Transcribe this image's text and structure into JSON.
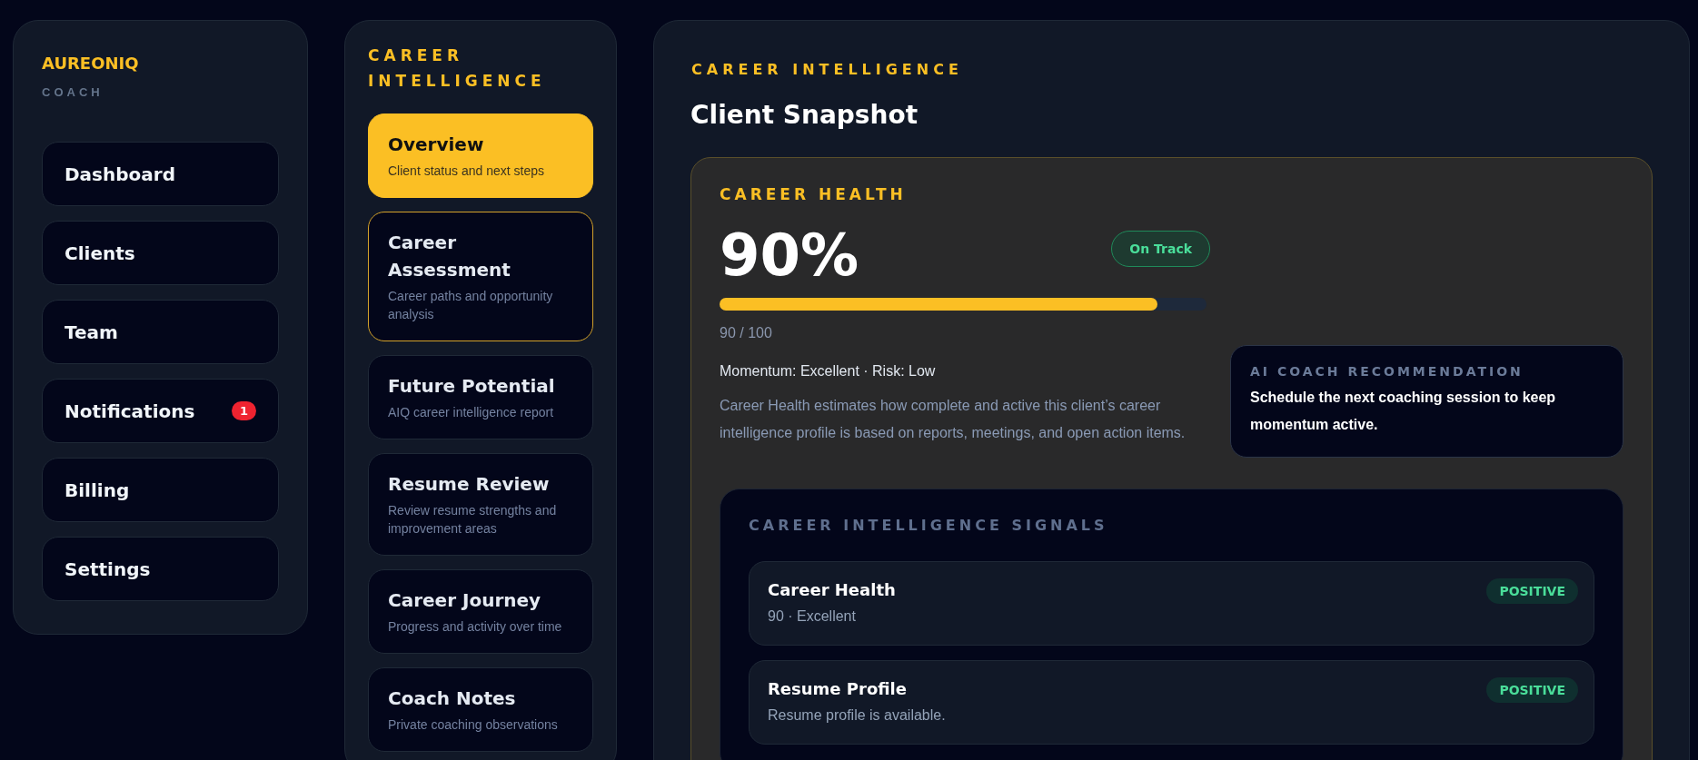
{
  "sidebar": {
    "brand": "AUREONIQ",
    "subtitle": "COACH",
    "items": [
      {
        "label": "Dashboard",
        "selected": false
      },
      {
        "label": "Clients",
        "selected": false
      },
      {
        "label": "Team",
        "selected": false
      },
      {
        "label": "Notifications",
        "selected": false,
        "badge": "1"
      },
      {
        "label": "Billing",
        "selected": false
      },
      {
        "label": "Settings",
        "selected": false
      }
    ]
  },
  "section_nav": {
    "heading": "CAREER INTELLIGENCE",
    "items": [
      {
        "title": "Overview",
        "description": "Client status and next steps",
        "selected": true,
        "focused": false
      },
      {
        "title": "Career Assessment",
        "description": "Career paths and opportunity analysis",
        "selected": false,
        "focused": true
      },
      {
        "title": "Future Potential",
        "description": "AIQ career intelligence report",
        "selected": false,
        "focused": false
      },
      {
        "title": "Resume Review",
        "description": "Review resume strengths and improvement areas",
        "selected": false,
        "focused": false
      },
      {
        "title": "Career Journey",
        "description": "Progress and activity over time",
        "selected": false,
        "focused": false
      },
      {
        "title": "Coach Notes",
        "description": "Private coaching observations",
        "selected": false,
        "focused": false
      }
    ]
  },
  "main": {
    "eyebrow": "CAREER INTELLIGENCE",
    "title": "Client Snapshot",
    "health": {
      "label": "CAREER HEALTH",
      "score": "90%",
      "status": "On Track",
      "level": 0.9,
      "reading": "90 / 100",
      "summary": "Momentum: Excellent · Risk: Low",
      "description": "Career Health estimates how complete and active this client’s career intelligence profile is based on reports, meetings, and open action items.",
      "recommendation": {
        "label": "AI COACH RECOMMENDATION",
        "text": "Schedule the next coaching session to keep momentum active."
      }
    },
    "signals": {
      "heading": "CAREER INTELLIGENCE SIGNALS",
      "items": [
        {
          "title": "Career Health",
          "detail": "90 · Excellent",
          "status": "POSITIVE",
          "kind": "positive"
        },
        {
          "title": "Resume Profile",
          "detail": "Resume profile is available.",
          "status": "POSITIVE",
          "kind": "positive"
        }
      ]
    }
  }
}
